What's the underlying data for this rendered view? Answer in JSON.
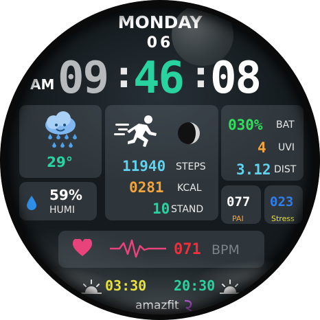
{
  "date": {
    "day": "MONDAY",
    "date": "06"
  },
  "time": {
    "ampm": "AM",
    "hour": "09",
    "minute": "46",
    "second": "08",
    "separator": ":"
  },
  "weather": {
    "temperature": "29°",
    "icon": "rain-cloud-icon"
  },
  "humidity": {
    "value": "59%",
    "label": "HUMI",
    "icon": "water-drop-icon"
  },
  "activity": {
    "icon": "running-person-icon",
    "moon_icon": "moon-phase-icon",
    "steps": {
      "value": "11940",
      "label": "STEPS"
    },
    "kcal": {
      "value": "0281",
      "label": "KCAL"
    },
    "stand": {
      "value": "10",
      "label": "STAND"
    }
  },
  "stats": {
    "battery": {
      "value": "030%",
      "label": "BAT"
    },
    "uvi": {
      "value": "4",
      "label": "UVI"
    },
    "distance": {
      "value": "3.12",
      "label": "DIST"
    }
  },
  "pai": {
    "value": "077",
    "label": "PAI"
  },
  "stress": {
    "value": "023",
    "label": "Stress"
  },
  "heart": {
    "value": "071",
    "label": "BPM",
    "icon": "heart-icon",
    "wave_icon": "heartbeat-wave-icon"
  },
  "sun": {
    "sunrise": "03:30",
    "sunset": "20:30"
  },
  "brand": "amazfit",
  "colors": {
    "accent_green": "#29d3a0",
    "battery_green": "#2fe05a",
    "orange": "#f2a53a",
    "cyan": "#5fd2ee",
    "red": "#ef2e3c",
    "yellow": "#e8e23a",
    "blue": "#2f7ff0"
  }
}
